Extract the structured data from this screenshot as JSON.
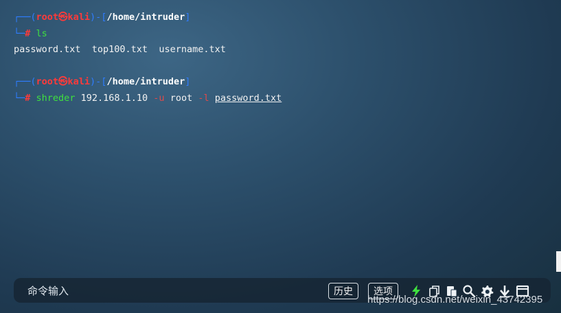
{
  "terminal": {
    "prompt1": {
      "corner_top": "┌──(",
      "user_host": "root㉿kali",
      "sep": ")-[",
      "path": "/home/intruder",
      "close": "]",
      "corner_bottom": "└─",
      "hash": "#",
      "command": "ls"
    },
    "output": "password.txt  top100.txt  username.txt",
    "prompt2": {
      "corner_top": "┌──(",
      "user_host": "root㉿kali",
      "sep": ")-[",
      "path": "/home/intruder",
      "close": "]",
      "corner_bottom": "└─",
      "hash": "#",
      "command": "shreder",
      "arg_ip": "192.168.1.10",
      "opt_u": "-u",
      "arg_user": "root",
      "opt_l": "-l",
      "arg_file": "password.txt"
    }
  },
  "bottom_bar": {
    "placeholder": "命令输入",
    "history_label": "历史",
    "options_label": "选项",
    "icons": [
      "lightning-icon",
      "copy-icon",
      "paste-icon",
      "search-icon",
      "gear-icon",
      "download-icon",
      "window-icon"
    ]
  },
  "watermark": "https://blog.csdn.net/weixin_43742395",
  "colors": {
    "prompt_blue": "#2f7dff",
    "prompt_red": "#ff3a3a",
    "command_green": "#3fe03f",
    "option_red": "#e04a4a",
    "lightning_green": "#3fe03f"
  }
}
